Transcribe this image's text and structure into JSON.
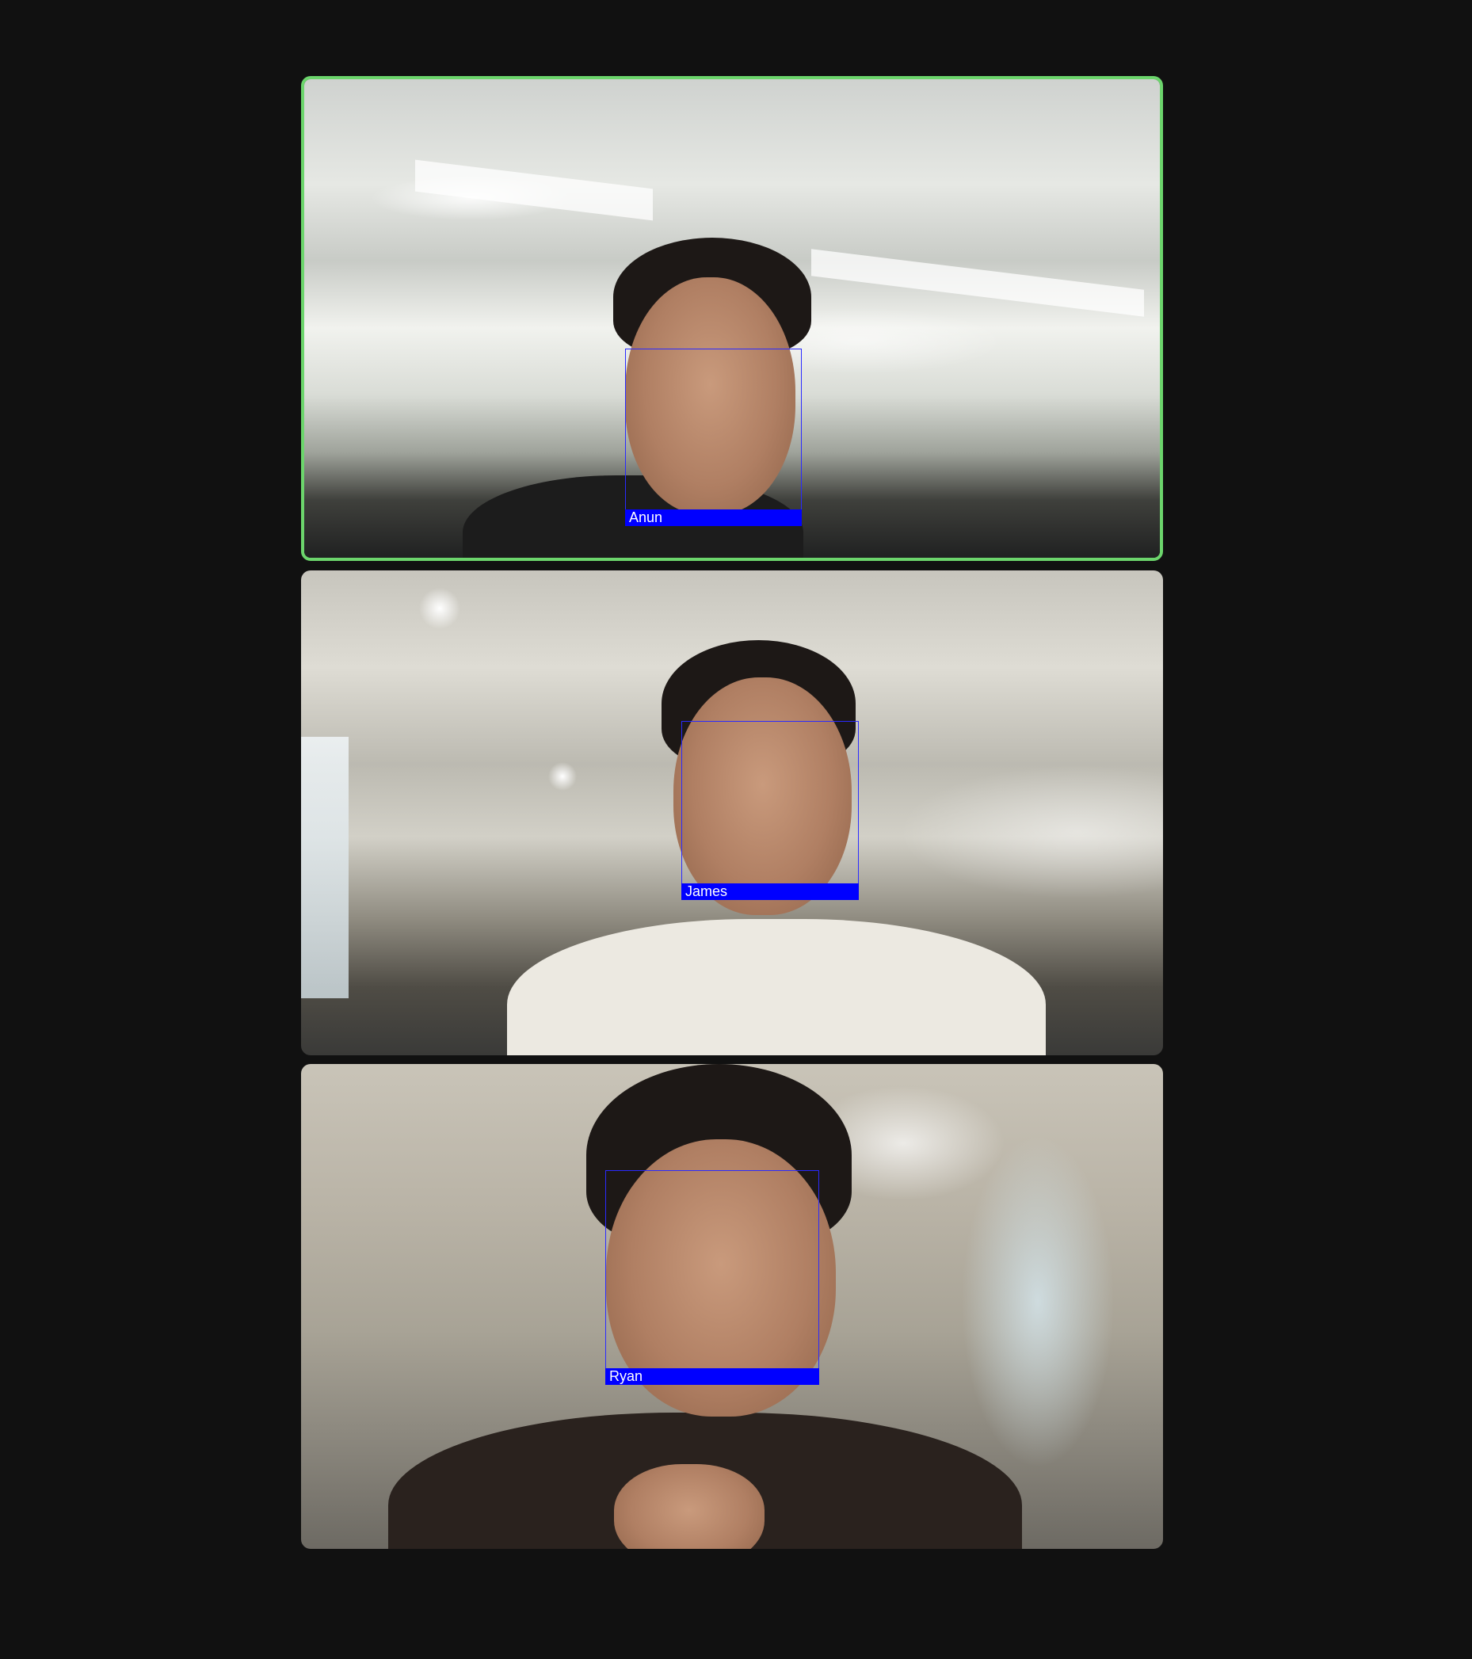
{
  "participants": [
    {
      "name": "Anun",
      "active_speaker": true
    },
    {
      "name": "James",
      "active_speaker": false
    },
    {
      "name": "Ryan",
      "active_speaker": false
    }
  ],
  "colors": {
    "background": "#111111",
    "active_speaker_border": "#6cd56c",
    "face_box": "#0000ff",
    "name_tag_text": "#ffffff"
  }
}
